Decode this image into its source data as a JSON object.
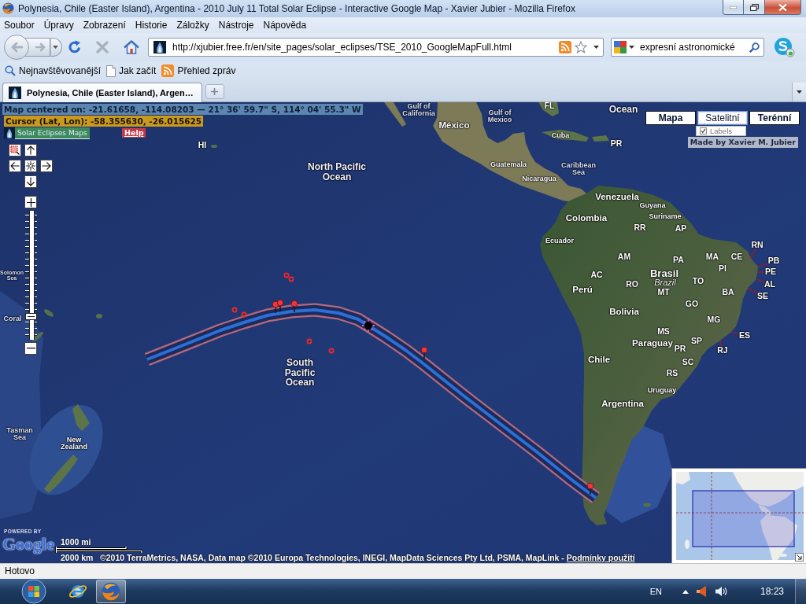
{
  "window": {
    "title": "Polynesia, Chile (Easter Island), Argentina - 2010 July 11 Total Solar Eclipse - Interactive Google Map - Xavier Jubier - Mozilla Firefox"
  },
  "menu": [
    "Soubor",
    "Úpravy",
    "Zobrazení",
    "Historie",
    "Záložky",
    "Nástroje",
    "Nápověda"
  ],
  "toolbar": {
    "back": {
      "disabled": true
    },
    "forward": {
      "disabled": true
    },
    "stop": {
      "disabled": true
    },
    "url": "http://xjubier.free.fr/en/site_pages/solar_eclipses/TSE_2010_GoogleMapFull.html",
    "search": "expresní astronomické"
  },
  "bookmarks": [
    {
      "label": "Nejnavštěvovanější",
      "kind": "smart"
    },
    {
      "label": "Jak začít",
      "kind": "page"
    },
    {
      "label": "Přehled zpráv",
      "kind": "feed"
    }
  ],
  "tabs": [
    {
      "label": "Polynesia, Chile (Easter Island), Argen…",
      "selected": true
    }
  ],
  "map": {
    "center_info": "Map centered on: -21.61658, -114.08203 — 21° 36' 59.7\" S, 114° 04' 55.3\" W",
    "cursor_info": "Cursor (Lat, Lon): -58.355630, -26.015625",
    "home_link": "Solar Eclipses Maps",
    "help_button": "Help",
    "zoom": {
      "level": 0.16
    },
    "map_types": [
      {
        "label": "Mapa",
        "selected": false
      },
      {
        "label": "Satelitní",
        "selected": true
      },
      {
        "label": "Terénní",
        "selected": false
      }
    ],
    "labels_option": {
      "label": "Labels",
      "checked": true
    },
    "credit": "Made by Xavier M. Jubier",
    "places": [
      {
        "label": "Gulf of California",
        "kind": "sea"
      },
      {
        "label": "México",
        "kind": "country"
      },
      {
        "label": "Gulf of Mexico",
        "kind": "sea"
      },
      {
        "label": "FL",
        "kind": "region"
      },
      {
        "label": "Ocean",
        "kind": "ocean"
      },
      {
        "label": "Cuba",
        "kind": "minor"
      },
      {
        "label": "HI",
        "kind": "region"
      },
      {
        "label": "PR",
        "kind": "region"
      },
      {
        "label": "North Pacific Ocean",
        "kind": "ocean"
      },
      {
        "label": "Guatemala",
        "kind": "minor"
      },
      {
        "label": "Caribbean Sea",
        "kind": "sea"
      },
      {
        "label": "Nicaragua",
        "kind": "minor"
      },
      {
        "label": "Venezuela",
        "kind": "country"
      },
      {
        "label": "Guyana",
        "kind": "minor"
      },
      {
        "label": "Colombia",
        "kind": "country"
      },
      {
        "label": "Suriname",
        "kind": "minor"
      },
      {
        "label": "RR",
        "kind": "region"
      },
      {
        "label": "AP",
        "kind": "region"
      },
      {
        "label": "Ecuador",
        "kind": "minor"
      },
      {
        "label": "RN",
        "kind": "region"
      },
      {
        "label": "AM",
        "kind": "region"
      },
      {
        "label": "PA",
        "kind": "region"
      },
      {
        "label": "MA",
        "kind": "region"
      },
      {
        "label": "CE",
        "kind": "region"
      },
      {
        "label": "PB",
        "kind": "region"
      },
      {
        "label": "Solomon Sea",
        "kind": "sea"
      },
      {
        "label": "AC",
        "kind": "region"
      },
      {
        "label": "Brasil",
        "kind": "major_country"
      },
      {
        "label": "PI",
        "kind": "region"
      },
      {
        "label": "PE",
        "kind": "region"
      },
      {
        "label": "Perú",
        "kind": "country"
      },
      {
        "label": "RO",
        "kind": "region"
      },
      {
        "label": "Brazil",
        "kind": "alternate_name"
      },
      {
        "label": "MT",
        "kind": "region"
      },
      {
        "label": "TO",
        "kind": "region"
      },
      {
        "label": "BA",
        "kind": "region"
      },
      {
        "label": "SE",
        "kind": "region"
      },
      {
        "label": "AL",
        "kind": "region"
      },
      {
        "label": "Bolivia",
        "kind": "country"
      },
      {
        "label": "GO",
        "kind": "region"
      },
      {
        "label": "Coral",
        "kind": "sea"
      },
      {
        "label": "MG",
        "kind": "region"
      },
      {
        "label": "MS",
        "kind": "region"
      },
      {
        "label": "Paraguay",
        "kind": "country"
      },
      {
        "label": "PR",
        "kind": "region"
      },
      {
        "label": "SP",
        "kind": "region"
      },
      {
        "label": "RJ",
        "kind": "region"
      },
      {
        "label": "ES",
        "kind": "region"
      },
      {
        "label": "South Pacific Ocean",
        "kind": "ocean"
      },
      {
        "label": "Chile",
        "kind": "country"
      },
      {
        "label": "SC",
        "kind": "region"
      },
      {
        "label": "RS",
        "kind": "region"
      },
      {
        "label": "Uruguay",
        "kind": "minor"
      },
      {
        "label": "Argentina",
        "kind": "country"
      },
      {
        "label": "Tasman Sea",
        "kind": "sea"
      },
      {
        "label": "New Zealand",
        "kind": "minor"
      }
    ],
    "scale": {
      "imperial": "1000 mi",
      "metric": "2000 km"
    },
    "logo": {
      "tagline": "POWERED BY",
      "name": "Google"
    },
    "attribution": {
      "text": "©2010 TerraMetrics, NASA, Data map ©2010 Europa Technologies, INEGI, MapData Sciences Pty Ltd, PSMA, MapLink -",
      "terms_link": "Podmínky použití"
    }
  },
  "status_bar": {
    "text": "Hotovo"
  },
  "taskbar": {
    "apps": [
      {
        "kind": "explorer",
        "active": false
      },
      {
        "kind": "firefox",
        "active": true
      }
    ],
    "language": "EN",
    "clock": "18:23"
  }
}
